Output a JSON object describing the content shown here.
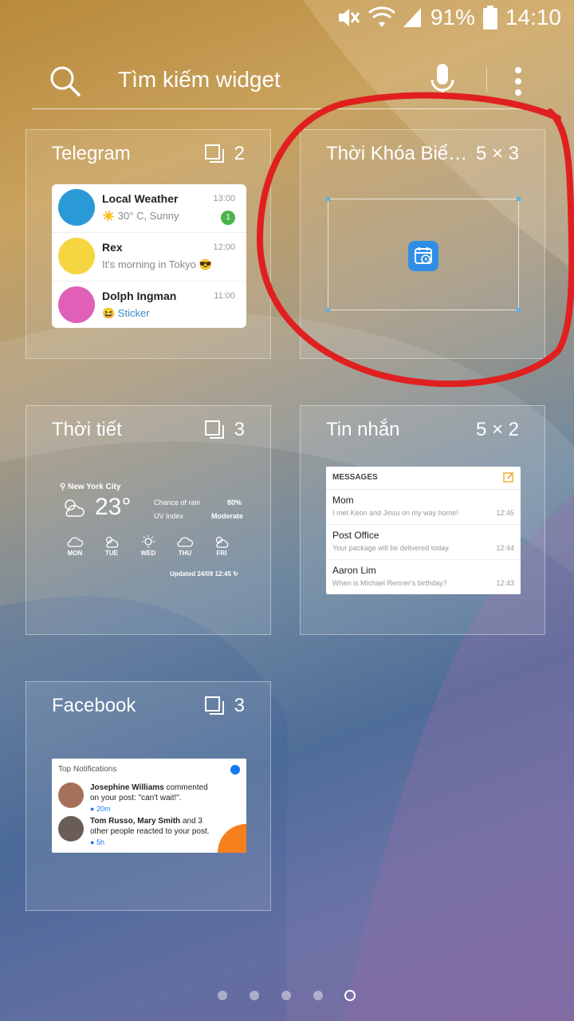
{
  "status": {
    "battery": "91%",
    "time": "14:10"
  },
  "search": {
    "placeholder": "Tìm kiếm widget"
  },
  "widgets": {
    "telegram": {
      "title": "Telegram",
      "count": "2",
      "chats": [
        {
          "name": "Local Weather",
          "message": "☀️ 30° C, Sunny",
          "time": "13:00",
          "badge": "1"
        },
        {
          "name": "Rex",
          "message": "It's morning in Tokyo 😎",
          "time": "12:00"
        },
        {
          "name": "Dolph Ingman",
          "message": "😆 Sticker",
          "time": "11:00"
        }
      ]
    },
    "schedule": {
      "title": "Thời Khóa Biểu ...",
      "size": "5 × 3"
    },
    "weather": {
      "title": "Thời tiết",
      "count": "3",
      "location": "New York City",
      "temp": "23°",
      "rain_label": "Chance of rain",
      "rain_value": "80%",
      "uv_label": "UV Index",
      "uv_value": "Moderate",
      "days": [
        "MON",
        "TUE",
        "WED",
        "THU",
        "FRI"
      ],
      "updated": "Updated 24/09 12:45"
    },
    "messages": {
      "title": "Tin nhắn",
      "size": "5 × 2",
      "header": "MESSAGES",
      "rows": [
        {
          "name": "Mom",
          "preview": "I met Keon and Jinsu on my way home!",
          "time": "12:45"
        },
        {
          "name": "Post Office",
          "preview": "Your package will be delivered today.",
          "time": "12:44"
        },
        {
          "name": "Aaron Lim",
          "preview": "When is Michael Renner's birthday?",
          "time": "12:43"
        }
      ]
    },
    "facebook": {
      "title": "Facebook",
      "count": "3",
      "header": "Top Notifications",
      "items": [
        {
          "name": "Josephine Williams",
          "text": " commented on your post: \"can't wait!\".",
          "age": "20m"
        },
        {
          "name": "Tom Russo, Mary Smith",
          "text": " and 3 other people reacted to your post.",
          "age": "5h"
        }
      ]
    }
  },
  "pager": {
    "pages": 5,
    "active": 5
  },
  "colors": {
    "annotation": "#e02020",
    "accent": "#2f8fe6"
  }
}
